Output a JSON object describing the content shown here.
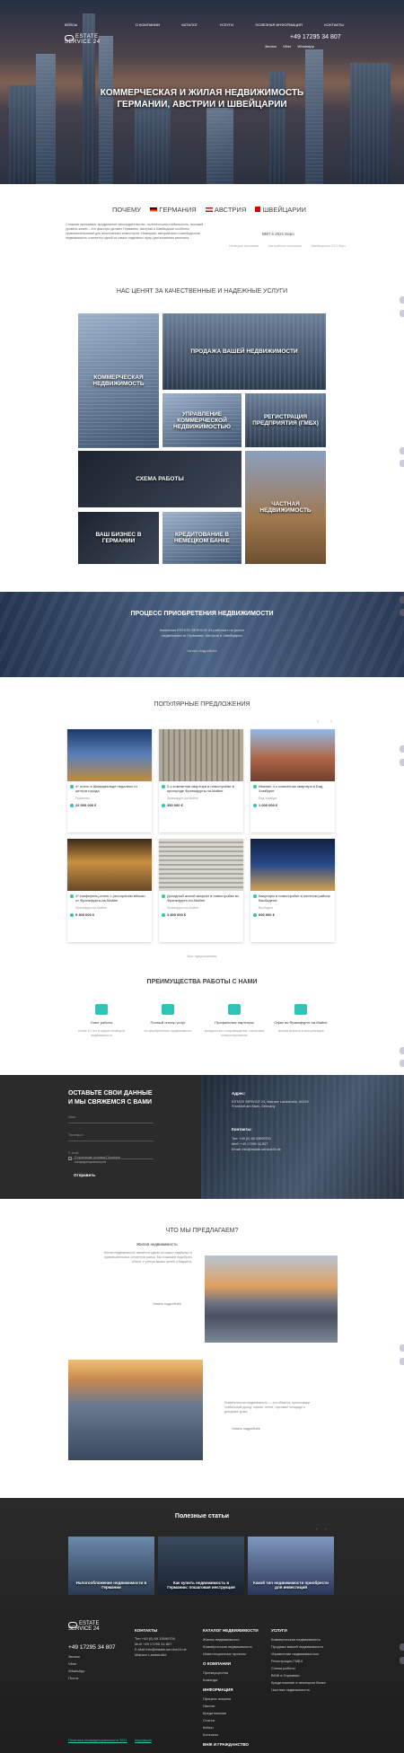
{
  "header": {
    "nav": [
      "Кейсы",
      "О компании",
      "Каталог",
      "Услуги",
      "Полезная информация",
      "Контакты"
    ],
    "logo_top": "ESTATE",
    "logo_bottom": "SERVICE 24",
    "phone": "+49 17295 34 807",
    "callback": "Звонок",
    "social": [
      "Viber",
      "WhatsApp"
    ],
    "hero_title": "Коммерческая и жилая недвижимость Германии, Австрии и Швейцарии"
  },
  "countries": {
    "tabs": [
      "Почему",
      "Германия",
      "Австрия",
      "Швейцарии"
    ],
    "intro": "Сложная экономика, продуманное законодательство, политическая стабильность, высокий уровень жизни – это факторы делают Германию, Австрию и Швейцарию особенно привлекательными для иностранных инвесторов. Немецкая, австрийская и швейцарская недвижимость считается одной из самых надёжных сфер для вложения капитала.",
    "stats_title": "ВВП в 2021 Евро",
    "stats": [
      "Немецкая экономика",
      "Австрийская экономика",
      "Швейцарская 2021 Евро"
    ]
  },
  "services": {
    "title": "Нас ценят за качественные и надежные услуги",
    "tiles": [
      "Коммерческая недвижимость",
      "Продажа вашей недвижимости",
      "Управление коммерческой недвижимостью",
      "Регистрация предприятия (ГМБХ)",
      "Схема работы",
      "Частная недвижимость",
      "Ваш бизнес в Германии",
      "Кредитование в немецком банке"
    ]
  },
  "process": {
    "title": "Процесс приобретения недвижимости",
    "text": "Компания ESTATE SERVICE 24 работает на рынке недвижимости Германии, Австрии и Швейцарии",
    "link": "Узнать подробнее"
  },
  "offers": {
    "title": "Популярные предложения",
    "cards": [
      {
        "title": "4* отель в Шварцвальде недалеко от центра города",
        "loc": "Германия",
        "price": "22 500 000 €"
      },
      {
        "title": "2-х комнатная квартира в новостройке в пригороде Франкфурта-на-Майне",
        "loc": "Франкфурт-на-Майне",
        "price": "350 000 €"
      },
      {
        "title": "Имение 4-х комнатная квартира в Бад Хомбурге",
        "loc": "Бад Хомбург",
        "price": "1 000 000 €"
      },
      {
        "title": "4* конференц-отель с рестораном вблизи от Франкфурта-на-Майне",
        "loc": "Франкфурт-на-Майне",
        "price": "5 300 000 €"
      },
      {
        "title": "Доходный жилой квартал в новостройке во Франкфурте-на-Майне",
        "loc": "Франкфурт-на-Майне",
        "price": "3 800 000 €"
      },
      {
        "title": "Квартиры в новостройке в элитном районе Висбадена",
        "loc": "Висбаден",
        "price": "690 000 €"
      }
    ],
    "more": "Все предложения"
  },
  "advantages": {
    "title": "Преимущества работы с нами",
    "items": [
      {
        "h": "Опыт работы",
        "d": "более 10 лет в сфере немецкой недвижимости"
      },
      {
        "h": "Полный спектр услуг",
        "d": "по приобретению недвижимости"
      },
      {
        "h": "Профильные партнеры",
        "d": "юридическое сопровождение, налоговое консультирование"
      },
      {
        "h": "Офис во Франкфурте-на-Майне",
        "d": "личная встреча и консультация"
      }
    ]
  },
  "contact": {
    "title": "Оставьте свои данные и мы свяжемся с вами",
    "fields": [
      "Имя",
      "Телефон",
      "E-mail"
    ],
    "consent": "Я принимаю условия Политики конфиденциальности",
    "submit": "Отправить",
    "address_h": "Адрес:",
    "address": "ESTATE SERVICE 24, Mainzer Landstraße, 60329 Frankfurt am Main, Germany",
    "contacts_h": "Контакты:",
    "contacts": [
      "Тел: +49 (0) 69 33099700",
      "Моб: +49 17295 34 807",
      "Email: info@estate-service24.de"
    ]
  },
  "offer_we": {
    "title": "Что мы предлагаем?",
    "h1": "Жилая недвижимость",
    "t1": "Жилая недвижимость является одним из самых надёжных и привлекательных сегментов рынка. Мы поможем подобрать объект с учётом ваших целей и бюджета.",
    "l1": "Узнать подробнее",
    "t2": "Коммерческая недвижимость — это объекты, приносящие стабильный доход: офисы, отели, торговые площади и доходные дома.",
    "l2": "Узнать подробнее"
  },
  "articles": {
    "title": "Полезные статьи",
    "items": [
      "Налогообложение недвижимости в Германии",
      "Как купить недвижимость в Германии: пошаговая инструкция",
      "Какой тип недвижимости приобрести для инвестиций"
    ]
  },
  "footer": {
    "phone": "+49 17295 34 807",
    "social": [
      "Звонок",
      "Viber",
      "WhatsApp",
      "Почта"
    ],
    "col_contacts_h": "Контакты",
    "contacts": [
      "Тел +49 (0) 69 33099700",
      "Моб +49 17295 34 807",
      "E-Mail info@estate-service24.de",
      "Mainzer Landstraße"
    ],
    "col_catalog_h": "Каталог недвижимости",
    "catalog": [
      "Жилая недвижимость",
      "Коммерческая недвижимость",
      "Инвестиционные проекты"
    ],
    "col_company_h": "О компании",
    "company": [
      "Преимущества",
      "Команда"
    ],
    "col_info_h": "Информация",
    "info": [
      "Процесс покупки",
      "Налоги",
      "Кредитование",
      "Статьи",
      "Кейсы",
      "Контакты"
    ],
    "col_services_h": "Услуги",
    "services": [
      "Коммерческая недвижимость",
      "Продажа вашей недвижимости",
      "Управление недвижимостью",
      "Регистрация ГМБХ",
      "Схема работы",
      "ВНЖ в Германии",
      "Кредитование в немецком банке",
      "Частная недвижимость"
    ],
    "bottom_left": "Политика конфиденциальности 2021",
    "bottom_mid": "Impressum",
    "vnzh": "ВНЖ и гражданство"
  }
}
